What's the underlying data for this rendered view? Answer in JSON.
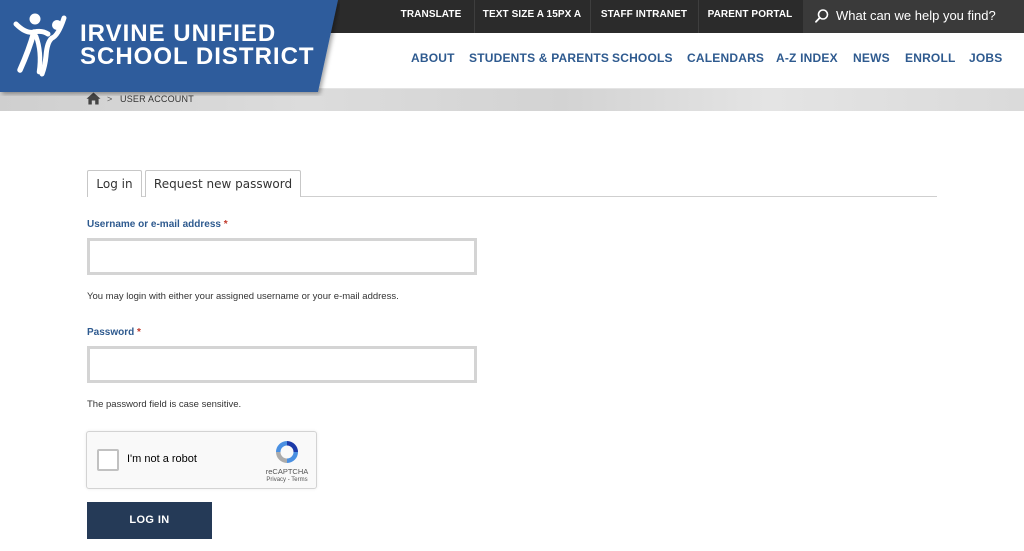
{
  "logo": {
    "line1": "IRVINE UNIFIED",
    "line2": "SCHOOL DISTRICT",
    "icon": "people-figure-icon",
    "color": "#2e5c9c"
  },
  "utility_nav": {
    "translate": "TRANSLATE",
    "text_size": "TEXT SIZE A 15PX A",
    "staff_intranet": "STAFF INTRANET",
    "parent_portal": "PARENT PORTAL"
  },
  "search": {
    "placeholder": "What can we help you find?",
    "icon": "search-icon"
  },
  "main_nav": [
    {
      "label": "ABOUT"
    },
    {
      "label": "STUDENTS & PARENTS"
    },
    {
      "label": "SCHOOLS"
    },
    {
      "label": "CALENDARS"
    },
    {
      "label": "A-Z INDEX"
    },
    {
      "label": "NEWS"
    },
    {
      "label": "ENROLL"
    },
    {
      "label": "JOBS"
    }
  ],
  "breadcrumb": {
    "home_icon": "home-icon",
    "separator": ">",
    "current": "USER ACCOUNT"
  },
  "tabs": [
    {
      "label": "Log in"
    },
    {
      "label": "Request new password"
    }
  ],
  "form": {
    "username_label": "Username or e-mail address",
    "username_value": "",
    "username_help": "You may login with either your assigned username or your e-mail address.",
    "password_label": "Password",
    "password_value": "",
    "password_help": "The password field is case sensitive.",
    "required_mark": "*",
    "submit_label": "LOG IN"
  },
  "recaptcha": {
    "label": "I'm not a robot",
    "brand": "reCAPTCHA",
    "links": "Privacy - Terms"
  },
  "colors": {
    "accent": "#2e5a8f",
    "topbar": "#2b2b2b",
    "button": "#253a57",
    "required": "#c0392b"
  }
}
